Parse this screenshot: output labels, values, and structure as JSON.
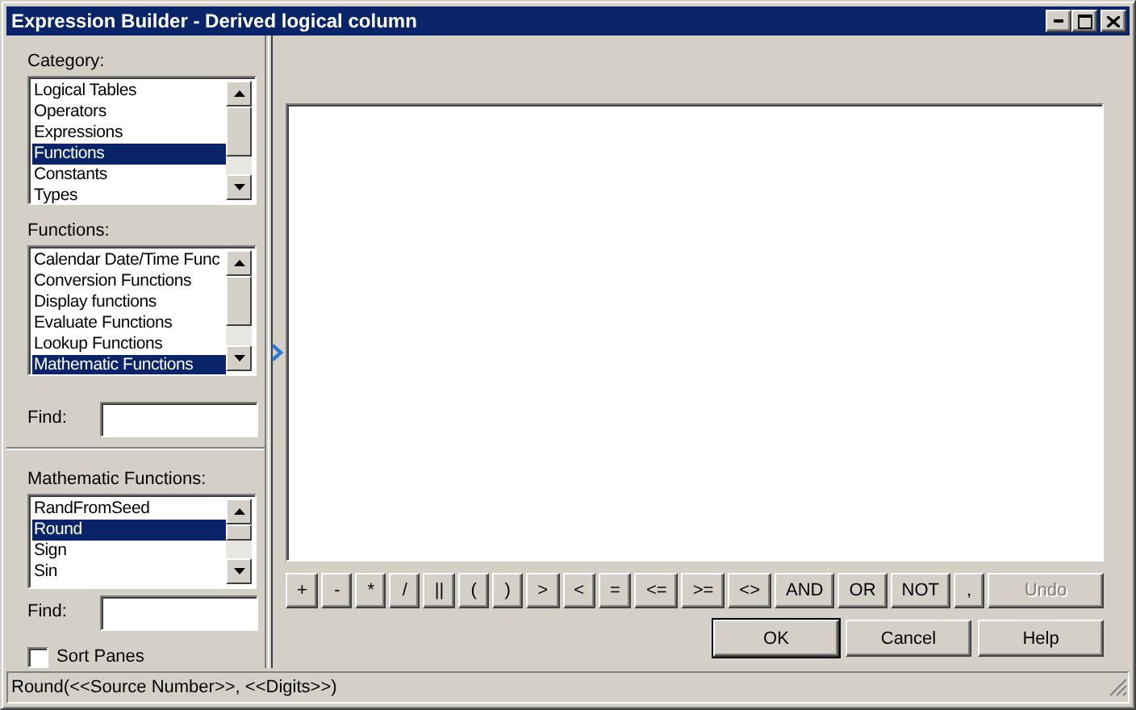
{
  "window": {
    "title": "Expression Builder - Derived logical column"
  },
  "category": {
    "label": "Category:",
    "items": [
      {
        "label": "Logical Tables",
        "selected": false
      },
      {
        "label": "Operators",
        "selected": false
      },
      {
        "label": "Expressions",
        "selected": false
      },
      {
        "label": "Functions",
        "selected": true
      },
      {
        "label": "Constants",
        "selected": false
      },
      {
        "label": "Types",
        "selected": false
      }
    ]
  },
  "functions": {
    "label": "Functions:",
    "items": [
      {
        "label": "Calendar Date/Time Func",
        "selected": false
      },
      {
        "label": "Conversion Functions",
        "selected": false
      },
      {
        "label": "Display functions",
        "selected": false
      },
      {
        "label": "Evaluate Functions",
        "selected": false
      },
      {
        "label": "Lookup Functions",
        "selected": false
      },
      {
        "label": "Mathematic Functions",
        "selected": true
      }
    ]
  },
  "find_functions": {
    "label": "Find:"
  },
  "function_list": {
    "label": "Mathematic Functions:",
    "items": [
      {
        "label": "RandFromSeed",
        "selected": false
      },
      {
        "label": "Round",
        "selected": true
      },
      {
        "label": "Sign",
        "selected": false
      },
      {
        "label": "Sin",
        "selected": false
      }
    ]
  },
  "find_list": {
    "label": "Find:"
  },
  "sort_panes": {
    "label": "Sort Panes",
    "checked": false
  },
  "operators": [
    {
      "label": "+",
      "disabled": false
    },
    {
      "label": "-",
      "disabled": false
    },
    {
      "label": "*",
      "disabled": false
    },
    {
      "label": "/",
      "disabled": false
    },
    {
      "label": "||",
      "disabled": false
    },
    {
      "label": "(",
      "disabled": false
    },
    {
      "label": ")",
      "disabled": false
    },
    {
      "label": ">",
      "disabled": false
    },
    {
      "label": "<",
      "disabled": false
    },
    {
      "label": "=",
      "disabled": false
    },
    {
      "label": "<=",
      "disabled": false
    },
    {
      "label": ">=",
      "disabled": false
    },
    {
      "label": "<>",
      "disabled": false
    },
    {
      "label": "AND",
      "disabled": false
    },
    {
      "label": "OR",
      "disabled": false
    },
    {
      "label": "NOT",
      "disabled": false
    },
    {
      "label": ",",
      "disabled": false
    }
  ],
  "undo": {
    "label": "Undo",
    "disabled": true
  },
  "buttons": [
    {
      "label": "OK",
      "default": true
    },
    {
      "label": "Cancel",
      "default": false
    },
    {
      "label": "Help",
      "default": false
    }
  ],
  "status_bar": "Round(<<Source Number>>, <<Digits>>)"
}
